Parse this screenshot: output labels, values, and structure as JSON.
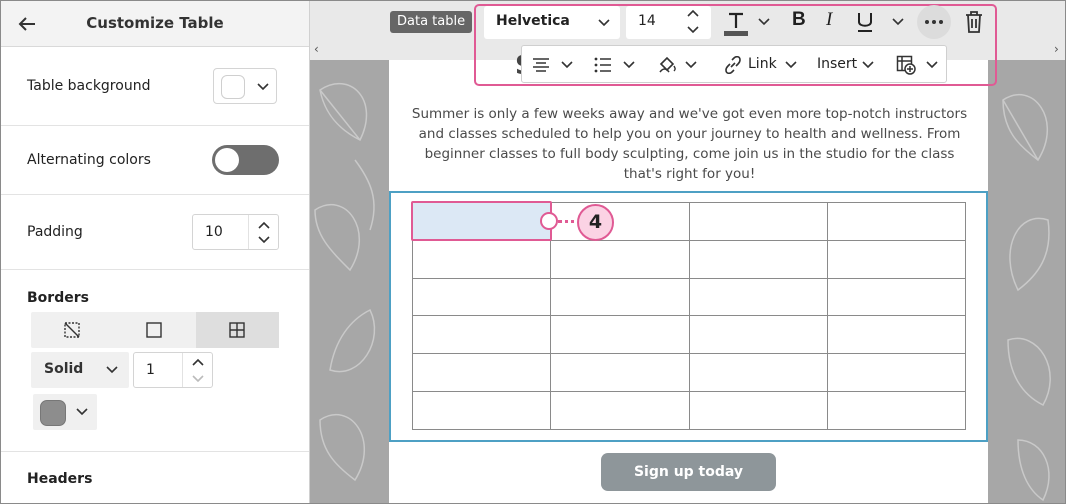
{
  "panel": {
    "title": "Customize Table",
    "table_background_label": "Table background",
    "alternating_colors_label": "Alternating colors",
    "padding_label": "Padding",
    "padding_value": "10",
    "borders_label": "Borders",
    "border_style": "Solid",
    "border_width": "1",
    "headers_label": "Headers",
    "colors": {
      "table_background": "#ffffff",
      "border_color": "#8d8d8d"
    }
  },
  "canvas": {
    "data_table_tag": "Data table",
    "body_text": "Summer is only a few weeks away and we've got even more top-notch instructors and classes scheduled to help you on your journey to health and wellness. From beginner classes to full body sculpting, come join us in the studio for the class that's right for you!",
    "heading_fragment": "S",
    "signup_label": "Sign up today",
    "callout_number": "4",
    "table_rows": 6,
    "table_cols": 4
  },
  "toolbar": {
    "font": "Helvetica",
    "size": "14",
    "link_label": "Link",
    "insert_label": "Insert",
    "accent": "#e05a94"
  }
}
